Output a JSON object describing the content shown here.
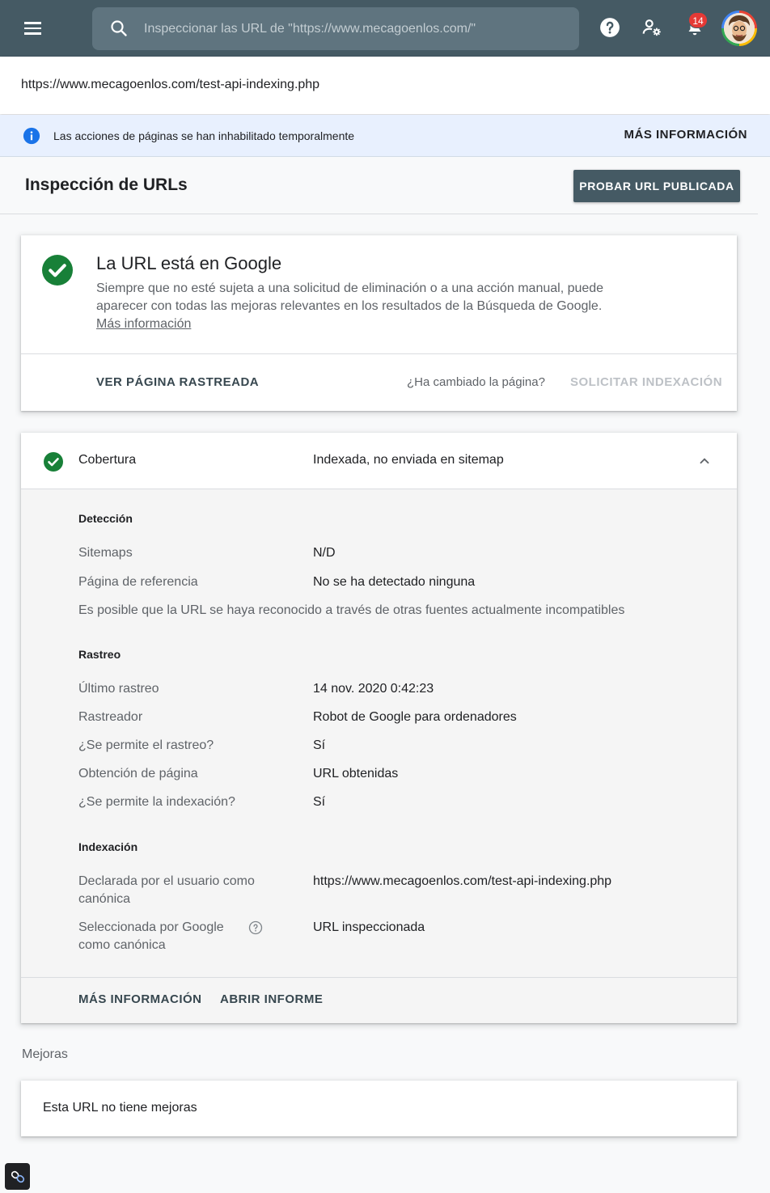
{
  "topbar": {
    "search_placeholder": "Inspeccionar las URL de \"https://www.mecagoenlos.com/\"",
    "notification_count": "14",
    "bg_color": "#455a64"
  },
  "url_bar": {
    "url": "https://www.mecagoenlos.com/test-api-indexing.php"
  },
  "info_banner": {
    "text": "Las acciones de páginas se han inhabilitado temporalmente",
    "action": "MÁS INFORMACIÓN"
  },
  "header": {
    "title": "Inspección de URLs",
    "test_button": "PROBAR URL PUBLICADA"
  },
  "status_card": {
    "title": "La URL está en Google",
    "description": "Siempre que no esté sujeta a una solicitud de eliminación o a una acción manual, puede aparecer con todas las mejoras relevantes en los resultados de la Búsqueda de Google.",
    "learn_more": "Más información",
    "view_crawled": "VER PÁGINA RASTREADA",
    "changed_question": "¿Ha cambiado la página?",
    "request_indexing": "SOLICITAR INDEXACIÓN"
  },
  "coverage": {
    "label": "Cobertura",
    "value": "Indexada, no enviada en sitemap",
    "discovery": {
      "title": "Detección",
      "rows": [
        {
          "label": "Sitemaps",
          "value": "N/D"
        },
        {
          "label": "Página de referencia",
          "value": "No se ha detectado ninguna"
        }
      ],
      "note": "Es posible que la URL se haya reconocido a través de otras fuentes actualmente incompatibles"
    },
    "crawl": {
      "title": "Rastreo",
      "rows": [
        {
          "label": "Último rastreo",
          "value": "14 nov. 2020 0:42:23"
        },
        {
          "label": "Rastreador",
          "value": "Robot de Google para ordenadores"
        },
        {
          "label": "¿Se permite el rastreo?",
          "value": "Sí"
        },
        {
          "label": "Obtención de página",
          "value": "URL obtenidas"
        },
        {
          "label": "¿Se permite la indexación?",
          "value": "Sí"
        }
      ]
    },
    "indexing": {
      "title": "Indexación",
      "rows": [
        {
          "label": "Declarada por el usuario como canónica",
          "value": "https://www.mecagoenlos.com/test-api-indexing.php"
        },
        {
          "label": "Seleccionada por Google como canónica",
          "value": "URL inspeccionada"
        }
      ]
    },
    "more_info": "MÁS INFORMACIÓN",
    "open_report": "ABRIR INFORME"
  },
  "enhancements": {
    "label": "Mejoras",
    "empty_text": "Esta URL no tiene mejoras"
  },
  "colors": {
    "success": "#188038",
    "info": "#1a73e8",
    "primary_dark": "#455a64"
  }
}
